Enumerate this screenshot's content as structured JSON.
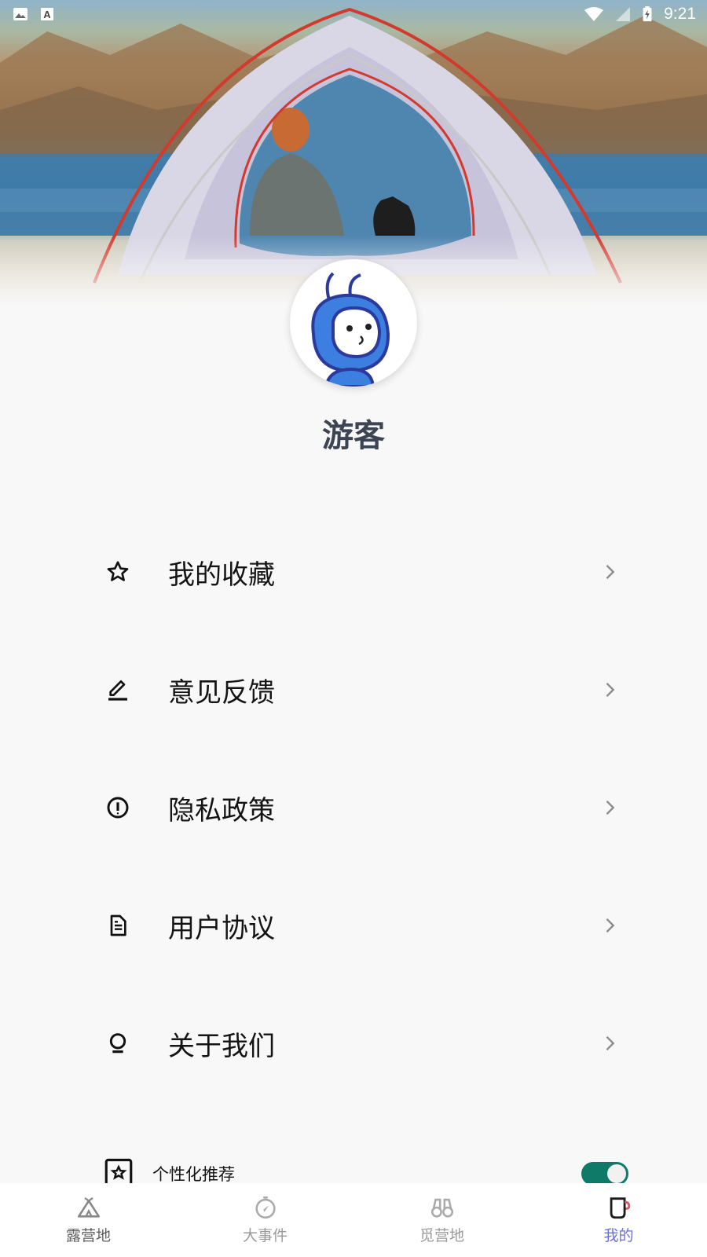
{
  "status_bar": {
    "time": "9:21",
    "left_icons": [
      "image-icon",
      "keyboard-a-icon"
    ],
    "right_icons": [
      "wifi-icon",
      "signal-icon",
      "battery-charging-icon"
    ]
  },
  "profile": {
    "name": "游客",
    "avatar": "robot-avatar"
  },
  "menu": {
    "items": [
      {
        "label": "我的收藏",
        "icon": "star-icon"
      },
      {
        "label": "意见反馈",
        "icon": "pencil-icon"
      },
      {
        "label": "隐私政策",
        "icon": "info-circle-icon"
      },
      {
        "label": "用户协议",
        "icon": "document-icon"
      },
      {
        "label": "关于我们",
        "icon": "bulb-icon"
      }
    ],
    "personalized": {
      "label": "个性化推荐",
      "enabled": true
    }
  },
  "bottom_nav": {
    "items": [
      {
        "label": "露营地",
        "icon": "tent-icon"
      },
      {
        "label": "大事件",
        "icon": "compass-icon"
      },
      {
        "label": "觅营地",
        "icon": "binoculars-icon"
      },
      {
        "label": "我的",
        "icon": "cup-icon"
      }
    ],
    "active_index": 3
  },
  "colors": {
    "accent": "#6b6fd8",
    "toggle_on": "#0f7a68",
    "title_text": "#3d4454"
  }
}
